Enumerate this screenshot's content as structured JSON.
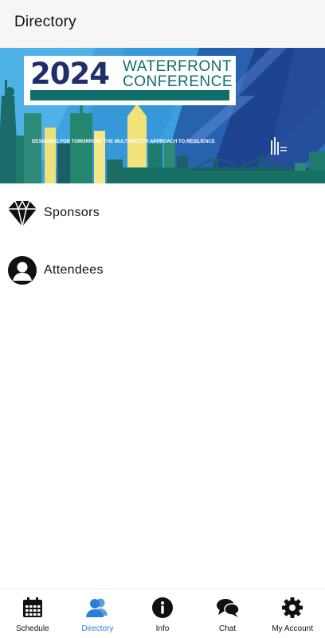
{
  "header": {
    "title": "Directory"
  },
  "banner": {
    "year": "2024",
    "line1": "WATERFRONT",
    "line2": "CONFERENCE",
    "tagline": "DESIGNING FOR TOMORROW: THE MULTISECTOR APPROACH TO RESILIENCE"
  },
  "directory": {
    "items": [
      {
        "label": "Sponsors",
        "icon": "diamond-icon"
      },
      {
        "label": "Attendees",
        "icon": "person-icon"
      }
    ]
  },
  "tabs": [
    {
      "label": "Schedule",
      "icon": "calendar-icon",
      "active": false
    },
    {
      "label": "Directory",
      "icon": "people-icon",
      "active": true
    },
    {
      "label": "Info",
      "icon": "info-icon",
      "active": false
    },
    {
      "label": "Chat",
      "icon": "chat-icon",
      "active": false
    },
    {
      "label": "My Account",
      "icon": "gear-icon",
      "active": false
    }
  ],
  "colors": {
    "accent": "#2a7fd4",
    "banner_navy": "#1e2f6b",
    "banner_teal": "#0f6f68"
  }
}
